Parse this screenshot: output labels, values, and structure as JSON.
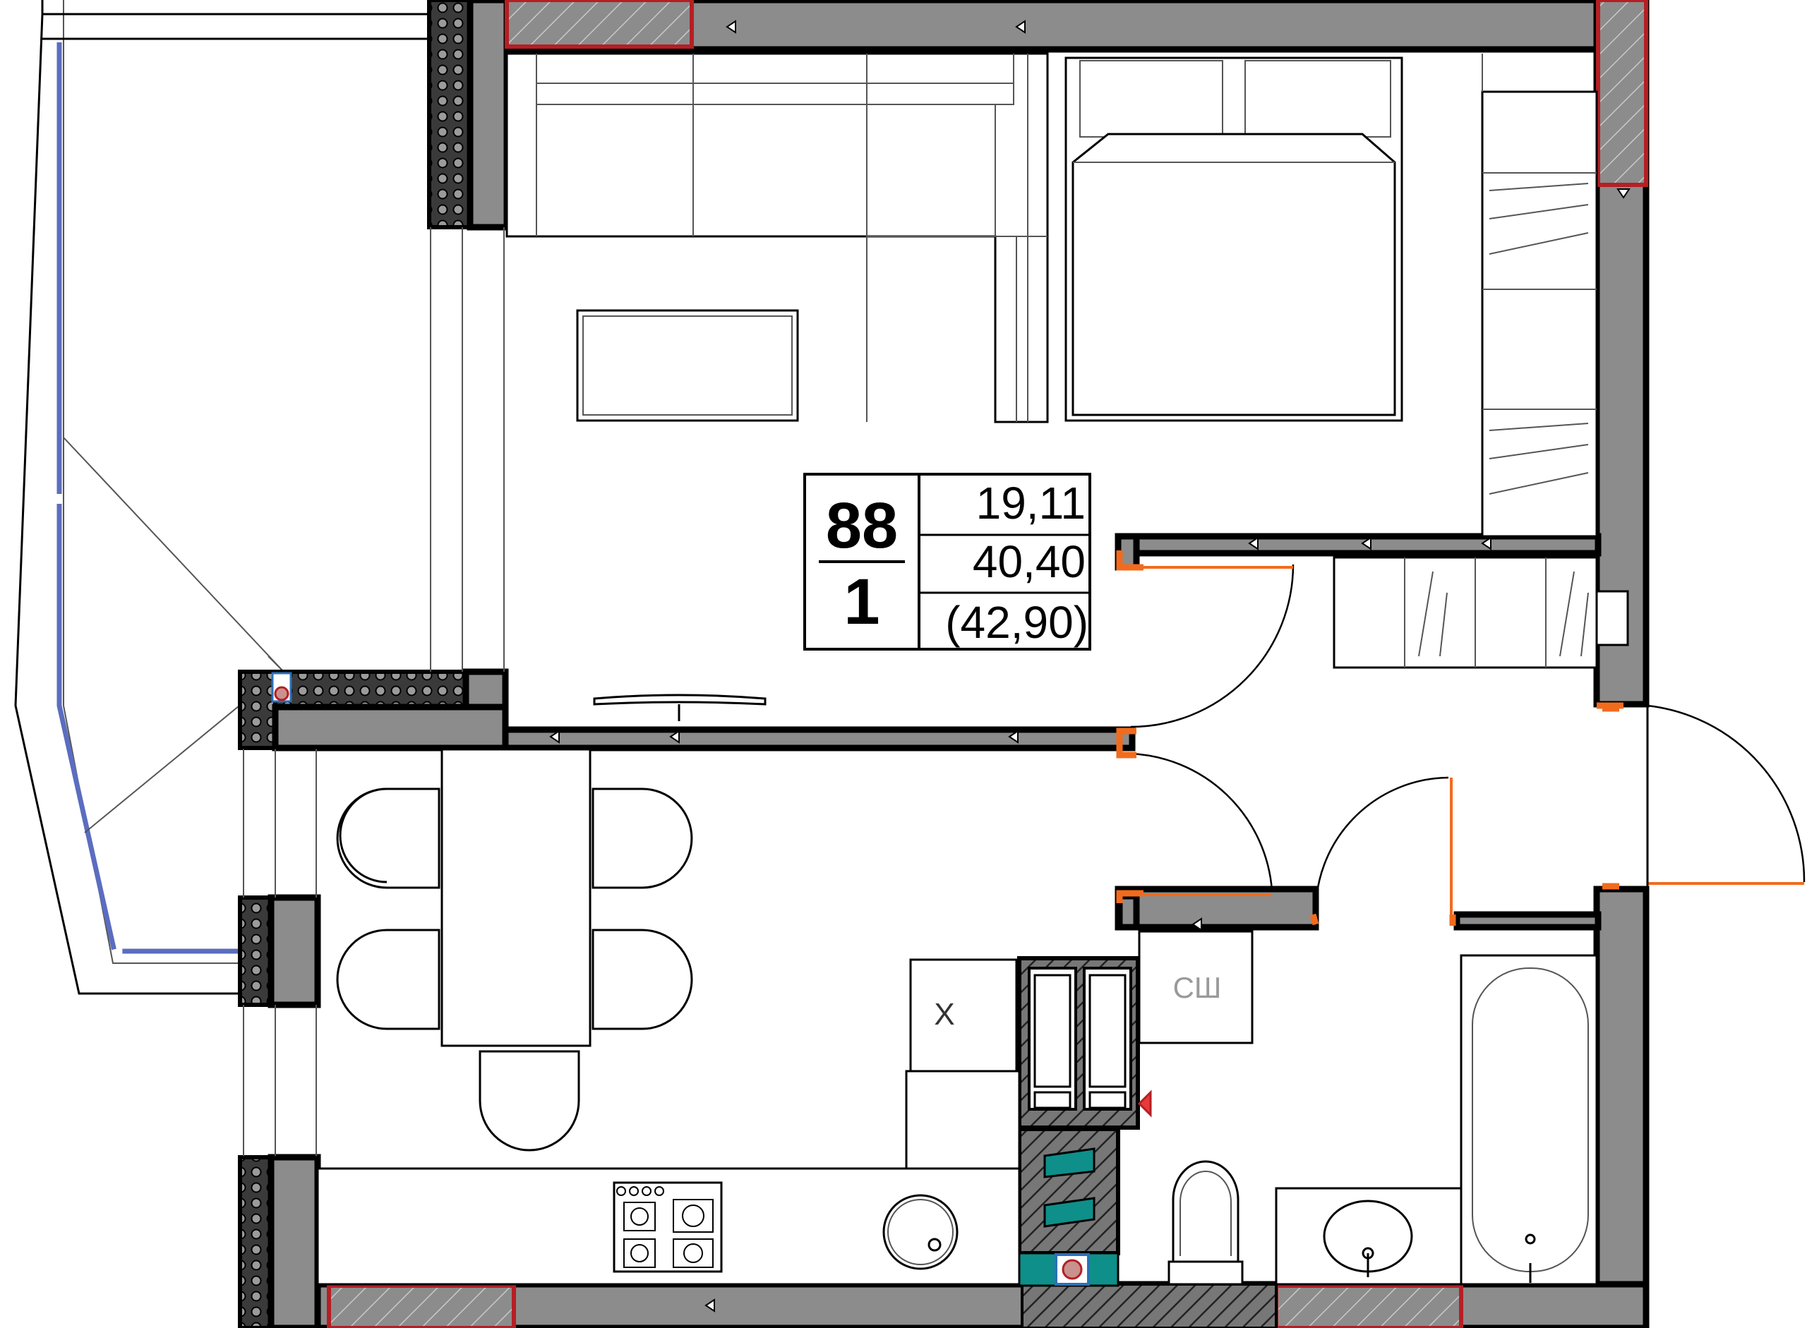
{
  "apartment": {
    "number": "88",
    "rooms": "1",
    "living_area": "19,11",
    "total_area": "40,40",
    "total_area_with_balcony": "(42,90)"
  },
  "fixtures": {
    "boiler_label": "X",
    "shaft_label": "СШ"
  },
  "colors": {
    "wall": "#8c8c8c",
    "window_frame": "#b51f24",
    "door_marker": "#f26b1d",
    "glazing": "#5b6dbf",
    "vent_accent": "#0e8f8a"
  }
}
